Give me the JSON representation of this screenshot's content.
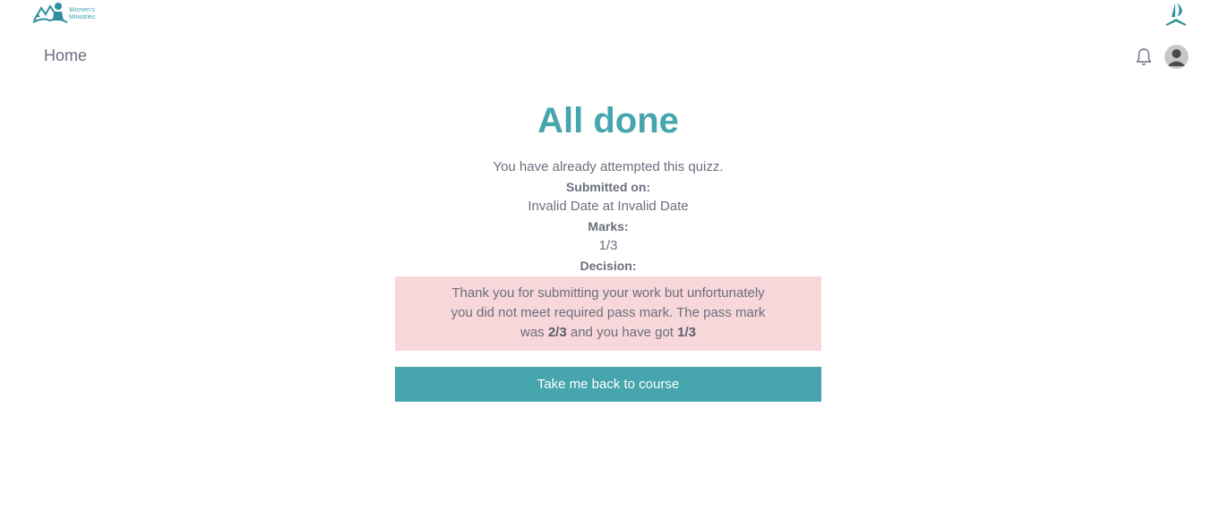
{
  "header": {
    "logo_text_line1": "Women's",
    "logo_text_line2": "Ministries",
    "left_logo_icon": "womens-ministries-logo",
    "right_logo_icon": "church-logo"
  },
  "nav": {
    "home_label": "Home",
    "notification_icon": "bell-icon",
    "avatar_icon": "user-avatar"
  },
  "result": {
    "title": "All done",
    "message": "You have already attempted this quizz.",
    "submitted_label": "Submitted on:",
    "submitted_value": "Invalid Date at Invalid Date",
    "marks_label": "Marks:",
    "marks_value": "1/3",
    "decision_label": "Decision:",
    "decision_text_before": "Thank you for submitting your work but unfortunately you did not meet required pass mark. The pass mark was ",
    "pass_mark": "2/3",
    "decision_text_middle": " and you have got ",
    "score": "1/3",
    "back_button_label": "Take me back to course"
  },
  "colors": {
    "accent": "#46a5ad",
    "text": "#6b6f7e",
    "decision_bg": "#f7d7da",
    "logo": "#2f8f9a"
  }
}
